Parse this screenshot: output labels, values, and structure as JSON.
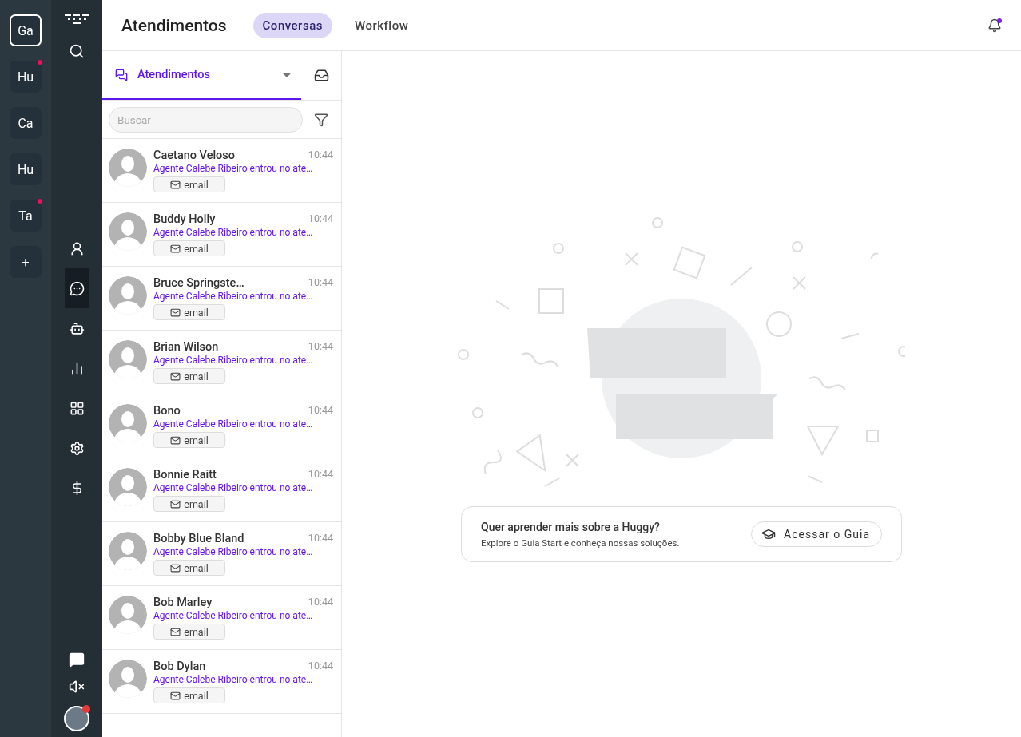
{
  "workspaces": [
    {
      "label": "Ga",
      "selected": true,
      "badge": false
    },
    {
      "label": "Hu",
      "selected": false,
      "badge": true
    },
    {
      "label": "Ca",
      "selected": false,
      "badge": false
    },
    {
      "label": "Hu",
      "selected": false,
      "badge": false
    },
    {
      "label": "Ta",
      "selected": false,
      "badge": true
    }
  ],
  "add_workspace": "+",
  "nav": [
    {
      "kind": "contacts",
      "selected": false
    },
    {
      "kind": "chats",
      "selected": true
    },
    {
      "kind": "bot",
      "selected": false
    },
    {
      "kind": "reports",
      "selected": false
    },
    {
      "kind": "apps",
      "selected": false
    },
    {
      "kind": "settings",
      "selected": false
    },
    {
      "kind": "billing",
      "selected": false
    }
  ],
  "user": {
    "badge": true
  },
  "header": {
    "title": "Atendimentos",
    "tabs": [
      {
        "label": "Conversas",
        "selected": true
      },
      {
        "label": "Workflow",
        "selected": false
      }
    ],
    "notification": true
  },
  "list": {
    "tab": "Atendimentos",
    "search": {
      "placeholder": "Buscar"
    },
    "items": [
      {
        "name": "Caetano Veloso",
        "time": "10:44",
        "preview": "Agente Calebe Ribeiro entrou no ate…",
        "channel": "email"
      },
      {
        "name": "Buddy Holly",
        "time": "10:44",
        "preview": "Agente Calebe Ribeiro entrou no ate…",
        "channel": "email"
      },
      {
        "name": "Bruce Springste…",
        "time": "10:44",
        "preview": "Agente Calebe Ribeiro entrou no ate…",
        "channel": "email"
      },
      {
        "name": "Brian Wilson",
        "time": "10:44",
        "preview": "Agente Calebe Ribeiro entrou no ate…",
        "channel": "email"
      },
      {
        "name": "Bono",
        "time": "10:44",
        "preview": "Agente Calebe Ribeiro entrou no ate…",
        "channel": "email"
      },
      {
        "name": "Bonnie Raitt",
        "time": "10:44",
        "preview": "Agente Calebe Ribeiro entrou no ate…",
        "channel": "email"
      },
      {
        "name": "Bobby Blue Bland",
        "time": "10:44",
        "preview": "Agente Calebe Ribeiro entrou no ate…",
        "channel": "email"
      },
      {
        "name": "Bob Marley",
        "time": "10:44",
        "preview": "Agente Calebe Ribeiro entrou no ate…",
        "channel": "email"
      },
      {
        "name": "Bob Dylan",
        "time": "10:44",
        "preview": "Agente Calebe Ribeiro entrou no ate…",
        "channel": "email"
      }
    ]
  },
  "guide": {
    "title": "Quer aprender mais sobre a Huggy?",
    "subtitle": "Explore o Guia Start e conheça nossas soluções.",
    "button": "Acessar o Guia"
  }
}
